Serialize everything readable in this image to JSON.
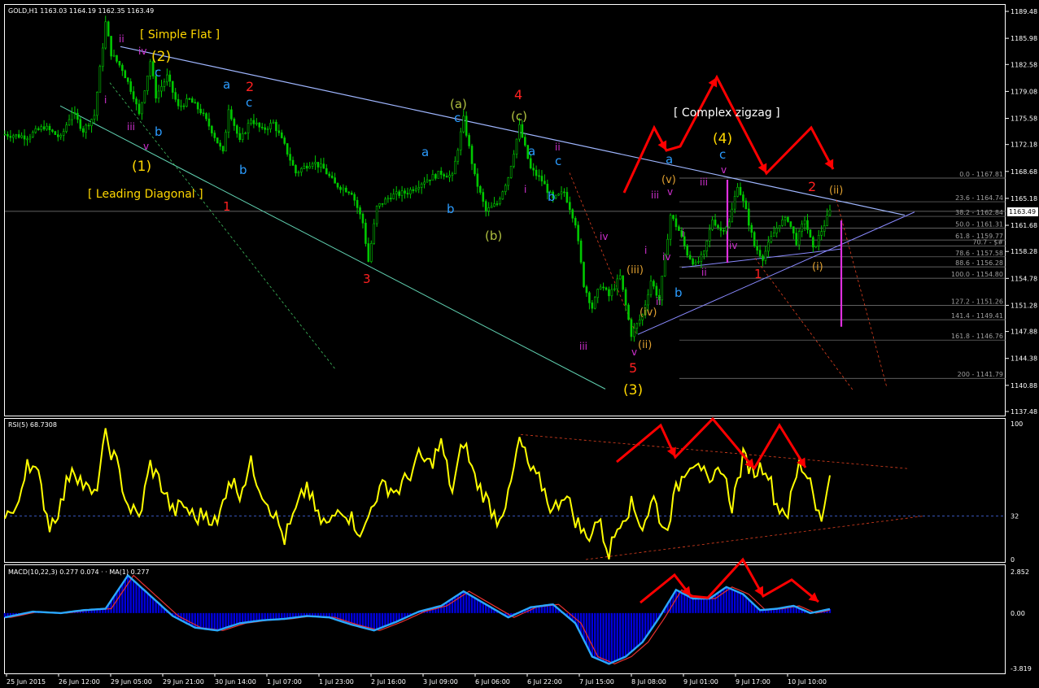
{
  "colors": {
    "background": "#000000",
    "frame": "#ffffff",
    "price_up": "#00c800",
    "rsi_line": "#ffff00",
    "macd_hist": "#0000dd",
    "macd_line": "#2aa8ff",
    "signal_line": "#e83030",
    "annotation_red": "#ff0000",
    "wave_yellow": "#ffd700",
    "wave_blue": "#2b9cff",
    "wave_magenta": "#d030d0",
    "wave_olive": "#b0c040",
    "fib_color": "#808080"
  },
  "main": {
    "title": "GOLD,H1  1163.03 1164.19 1162.35 1163.49",
    "current_price": "1163.49",
    "price_axis": [
      "1189.48",
      "1185.98",
      "1182.58",
      "1179.08",
      "1175.58",
      "1172.18",
      "1168.68",
      "1165.18",
      "1161.68",
      "1158.28",
      "1154.78",
      "1151.28",
      "1147.88",
      "1144.38",
      "1140.88",
      "1137.48"
    ],
    "fib_levels": [
      "0.0 - 1167.81",
      "23.6 - 1164.74",
      "38.2 - 1162.84",
      "50.0 - 1161.31",
      "61.8 - 1159.77",
      "70.7 - $#",
      "78.6 - 1157.58",
      "88.6 - 1156.28",
      "100.0 - 1154.80",
      "127.2 - 1151.26",
      "141.4 - 1149.41",
      "161.8 - 1146.76",
      "200 - 1141.79"
    ]
  },
  "annotations": {
    "simple_flat": "[ Simple Flat ]",
    "leading_diagonal": "[ Leading Diagonal ]",
    "complex_zigzag": "[ Complex zigzag ]",
    "wave_1": "(1)",
    "wave_2": "(2)",
    "wave_3": "(3)",
    "wave_4": "(4)",
    "red_1": "1",
    "red_2": "2",
    "red_3": "3",
    "red_4": "4",
    "red_5": "5",
    "red_1b": "1",
    "red_2b": "2",
    "label_a": "a",
    "label_b": "b",
    "label_c": "c",
    "label_i": "i",
    "label_ii": "ii",
    "label_iii": "iii",
    "label_iv": "iv",
    "label_v": "v",
    "label_pa": "(a)",
    "label_pb": "(b)",
    "label_pc": "(c)",
    "label_pi": "(i)",
    "label_pii": "(ii)",
    "label_piii": "(iii)",
    "label_piv": "(iv)",
    "label_pv": "(v)"
  },
  "rsi": {
    "title": "RSI(5) 68.7308",
    "axis": [
      "100",
      "32",
      "0"
    ]
  },
  "macd": {
    "title": "MACD(10,22,3) 0.277 0.074 · · MA(1) 0.277",
    "axis": [
      "2.852",
      "0.00",
      "-3.819"
    ]
  },
  "time_axis": [
    "25 Jun 2015",
    "26 Jun 12:00",
    "29 Jun 05:00",
    "29 Jun 21:00",
    "30 Jun 14:00",
    "1 Jul 07:00",
    "1 Jul 23:00",
    "2 Jul 16:00",
    "3 Jul 09:00",
    "6 Jul 06:00",
    "6 Jul 22:00",
    "7 Jul 15:00",
    "8 Jul 08:00",
    "9 Jul 01:00",
    "9 Jul 17:00",
    "10 Jul 10:00"
  ],
  "chart_data": [
    {
      "type": "candlestick",
      "title": "GOLD,H1",
      "ylim": [
        1137.48,
        1189.48
      ],
      "close_path": [
        {
          "t": 0,
          "p": 1173.5
        },
        {
          "t": 8,
          "p": 1173.2
        },
        {
          "t": 14,
          "p": 1174.5
        },
        {
          "t": 20,
          "p": 1173.0
        },
        {
          "t": 24,
          "p": 1176.5
        },
        {
          "t": 28,
          "p": 1174.0
        },
        {
          "t": 32,
          "p": 1176.0
        },
        {
          "t": 36,
          "p": 1188.0
        },
        {
          "t": 38,
          "p": 1184.0
        },
        {
          "t": 42,
          "p": 1182.0
        },
        {
          "t": 46,
          "p": 1178.5
        },
        {
          "t": 48,
          "p": 1176.0
        },
        {
          "t": 52,
          "p": 1183.0
        },
        {
          "t": 54,
          "p": 1178.5
        },
        {
          "t": 58,
          "p": 1181.0
        },
        {
          "t": 62,
          "p": 1177.0
        },
        {
          "t": 66,
          "p": 1178.0
        },
        {
          "t": 70,
          "p": 1176.5
        },
        {
          "t": 74,
          "p": 1174.0
        },
        {
          "t": 78,
          "p": 1171.0
        },
        {
          "t": 80,
          "p": 1177.0
        },
        {
          "t": 84,
          "p": 1172.5
        },
        {
          "t": 88,
          "p": 1175.5
        },
        {
          "t": 92,
          "p": 1174.0
        },
        {
          "t": 96,
          "p": 1175.0
        },
        {
          "t": 100,
          "p": 1172.0
        },
        {
          "t": 104,
          "p": 1168.5
        },
        {
          "t": 110,
          "p": 1170.0
        },
        {
          "t": 114,
          "p": 1169.0
        },
        {
          "t": 118,
          "p": 1167.0
        },
        {
          "t": 124,
          "p": 1166.0
        },
        {
          "t": 128,
          "p": 1162.0
        },
        {
          "t": 130,
          "p": 1157.0
        },
        {
          "t": 133,
          "p": 1164.0
        },
        {
          "t": 138,
          "p": 1165.5
        },
        {
          "t": 144,
          "p": 1166.0
        },
        {
          "t": 150,
          "p": 1167.5
        },
        {
          "t": 156,
          "p": 1168.5
        },
        {
          "t": 160,
          "p": 1168.0
        },
        {
          "t": 164,
          "p": 1175.5
        },
        {
          "t": 168,
          "p": 1168.0
        },
        {
          "t": 172,
          "p": 1163.5
        },
        {
          "t": 176,
          "p": 1164.5
        },
        {
          "t": 180,
          "p": 1168.0
        },
        {
          "t": 184,
          "p": 1174.5
        },
        {
          "t": 188,
          "p": 1169.0
        },
        {
          "t": 192,
          "p": 1167.5
        },
        {
          "t": 196,
          "p": 1165.0
        },
        {
          "t": 200,
          "p": 1166.0
        },
        {
          "t": 204,
          "p": 1162.0
        },
        {
          "t": 207,
          "p": 1154.0
        },
        {
          "t": 210,
          "p": 1151.0
        },
        {
          "t": 213,
          "p": 1154.0
        },
        {
          "t": 216,
          "p": 1152.5
        },
        {
          "t": 220,
          "p": 1155.0
        },
        {
          "t": 224,
          "p": 1147.5
        },
        {
          "t": 228,
          "p": 1150.0
        },
        {
          "t": 231,
          "p": 1154.5
        },
        {
          "t": 234,
          "p": 1152.0
        },
        {
          "t": 238,
          "p": 1163.0
        },
        {
          "t": 241,
          "p": 1161.0
        },
        {
          "t": 244,
          "p": 1158.0
        },
        {
          "t": 247,
          "p": 1156.5
        },
        {
          "t": 250,
          "p": 1158.0
        },
        {
          "t": 253,
          "p": 1162.5
        },
        {
          "t": 256,
          "p": 1161.0
        },
        {
          "t": 259,
          "p": 1162.0
        },
        {
          "t": 262,
          "p": 1167.0
        },
        {
          "t": 265,
          "p": 1163.5
        },
        {
          "t": 268,
          "p": 1159.0
        },
        {
          "t": 271,
          "p": 1157.5
        },
        {
          "t": 274,
          "p": 1160.0
        },
        {
          "t": 277,
          "p": 1162.0
        },
        {
          "t": 280,
          "p": 1162.5
        },
        {
          "t": 283,
          "p": 1159.5
        },
        {
          "t": 286,
          "p": 1162.5
        },
        {
          "t": 289,
          "p": 1158.5
        },
        {
          "t": 292,
          "p": 1161.0
        },
        {
          "t": 295,
          "p": 1163.49
        }
      ]
    },
    {
      "type": "line",
      "title": "RSI(5) 68.7308",
      "ylim": [
        0,
        100
      ],
      "reference_level": 32,
      "current": 68.7308,
      "path": [
        {
          "t": 0,
          "v": 35
        },
        {
          "t": 4,
          "v": 33
        },
        {
          "t": 8,
          "v": 75
        },
        {
          "t": 12,
          "v": 60
        },
        {
          "t": 16,
          "v": 25
        },
        {
          "t": 20,
          "v": 40
        },
        {
          "t": 24,
          "v": 70
        },
        {
          "t": 28,
          "v": 55
        },
        {
          "t": 32,
          "v": 45
        },
        {
          "t": 36,
          "v": 90
        },
        {
          "t": 40,
          "v": 70
        },
        {
          "t": 44,
          "v": 40
        },
        {
          "t": 48,
          "v": 30
        },
        {
          "t": 52,
          "v": 70
        },
        {
          "t": 56,
          "v": 55
        },
        {
          "t": 60,
          "v": 35
        },
        {
          "t": 64,
          "v": 40
        },
        {
          "t": 68,
          "v": 30
        },
        {
          "t": 72,
          "v": 35
        },
        {
          "t": 76,
          "v": 25
        },
        {
          "t": 80,
          "v": 60
        },
        {
          "t": 84,
          "v": 50
        },
        {
          "t": 88,
          "v": 70
        },
        {
          "t": 92,
          "v": 50
        },
        {
          "t": 96,
          "v": 35
        },
        {
          "t": 100,
          "v": 15
        },
        {
          "t": 104,
          "v": 35
        },
        {
          "t": 108,
          "v": 55
        },
        {
          "t": 112,
          "v": 30
        },
        {
          "t": 116,
          "v": 25
        },
        {
          "t": 120,
          "v": 40
        },
        {
          "t": 124,
          "v": 30
        },
        {
          "t": 128,
          "v": 18
        },
        {
          "t": 132,
          "v": 45
        },
        {
          "t": 136,
          "v": 55
        },
        {
          "t": 140,
          "v": 50
        },
        {
          "t": 144,
          "v": 60
        },
        {
          "t": 148,
          "v": 75
        },
        {
          "t": 152,
          "v": 70
        },
        {
          "t": 156,
          "v": 85
        },
        {
          "t": 160,
          "v": 50
        },
        {
          "t": 164,
          "v": 88
        },
        {
          "t": 168,
          "v": 60
        },
        {
          "t": 172,
          "v": 45
        },
        {
          "t": 176,
          "v": 30
        },
        {
          "t": 180,
          "v": 45
        },
        {
          "t": 184,
          "v": 88
        },
        {
          "t": 188,
          "v": 65
        },
        {
          "t": 192,
          "v": 55
        },
        {
          "t": 196,
          "v": 35
        },
        {
          "t": 200,
          "v": 50
        },
        {
          "t": 204,
          "v": 30
        },
        {
          "t": 208,
          "v": 15
        },
        {
          "t": 212,
          "v": 30
        },
        {
          "t": 216,
          "v": 5
        },
        {
          "t": 220,
          "v": 30
        },
        {
          "t": 224,
          "v": 40
        },
        {
          "t": 228,
          "v": 25
        },
        {
          "t": 232,
          "v": 45
        },
        {
          "t": 236,
          "v": 20
        },
        {
          "t": 240,
          "v": 50
        },
        {
          "t": 244,
          "v": 70
        },
        {
          "t": 248,
          "v": 75
        },
        {
          "t": 252,
          "v": 50
        },
        {
          "t": 256,
          "v": 70
        },
        {
          "t": 260,
          "v": 40
        },
        {
          "t": 264,
          "v": 75
        },
        {
          "t": 268,
          "v": 65
        },
        {
          "t": 272,
          "v": 70
        },
        {
          "t": 276,
          "v": 40
        },
        {
          "t": 280,
          "v": 35
        },
        {
          "t": 284,
          "v": 70
        },
        {
          "t": 288,
          "v": 60
        },
        {
          "t": 292,
          "v": 25
        },
        {
          "t": 295,
          "v": 68.7308
        }
      ]
    },
    {
      "type": "line",
      "title": "MACD(10,22,3)",
      "ylim": [
        -3.819,
        2.852
      ],
      "zero_line": 0,
      "current": 0.277,
      "path": [
        {
          "t": 0,
          "v": -0.3
        },
        {
          "t": 10,
          "v": 0.1
        },
        {
          "t": 20,
          "v": 0.0
        },
        {
          "t": 28,
          "v": 0.2
        },
        {
          "t": 36,
          "v": 0.3
        },
        {
          "t": 44,
          "v": 2.6
        },
        {
          "t": 52,
          "v": 1.2
        },
        {
          "t": 60,
          "v": -0.2
        },
        {
          "t": 68,
          "v": -1.0
        },
        {
          "t": 76,
          "v": -1.2
        },
        {
          "t": 84,
          "v": -0.7
        },
        {
          "t": 92,
          "v": -0.5
        },
        {
          "t": 100,
          "v": -0.4
        },
        {
          "t": 108,
          "v": -0.2
        },
        {
          "t": 116,
          "v": -0.3
        },
        {
          "t": 124,
          "v": -0.8
        },
        {
          "t": 132,
          "v": -1.2
        },
        {
          "t": 140,
          "v": -0.6
        },
        {
          "t": 148,
          "v": 0.1
        },
        {
          "t": 156,
          "v": 0.5
        },
        {
          "t": 164,
          "v": 1.5
        },
        {
          "t": 172,
          "v": 0.6
        },
        {
          "t": 180,
          "v": -0.3
        },
        {
          "t": 188,
          "v": 0.4
        },
        {
          "t": 196,
          "v": 0.6
        },
        {
          "t": 204,
          "v": -0.7
        },
        {
          "t": 210,
          "v": -3.0
        },
        {
          "t": 216,
          "v": -3.5
        },
        {
          "t": 222,
          "v": -3.0
        },
        {
          "t": 228,
          "v": -2.0
        },
        {
          "t": 234,
          "v": -0.3
        },
        {
          "t": 240,
          "v": 1.6
        },
        {
          "t": 246,
          "v": 1.0
        },
        {
          "t": 252,
          "v": 1.0
        },
        {
          "t": 258,
          "v": 1.8
        },
        {
          "t": 264,
          "v": 1.3
        },
        {
          "t": 270,
          "v": 0.2
        },
        {
          "t": 276,
          "v": 0.3
        },
        {
          "t": 282,
          "v": 0.5
        },
        {
          "t": 288,
          "v": 0.0
        },
        {
          "t": 295,
          "v": 0.277
        }
      ]
    }
  ]
}
